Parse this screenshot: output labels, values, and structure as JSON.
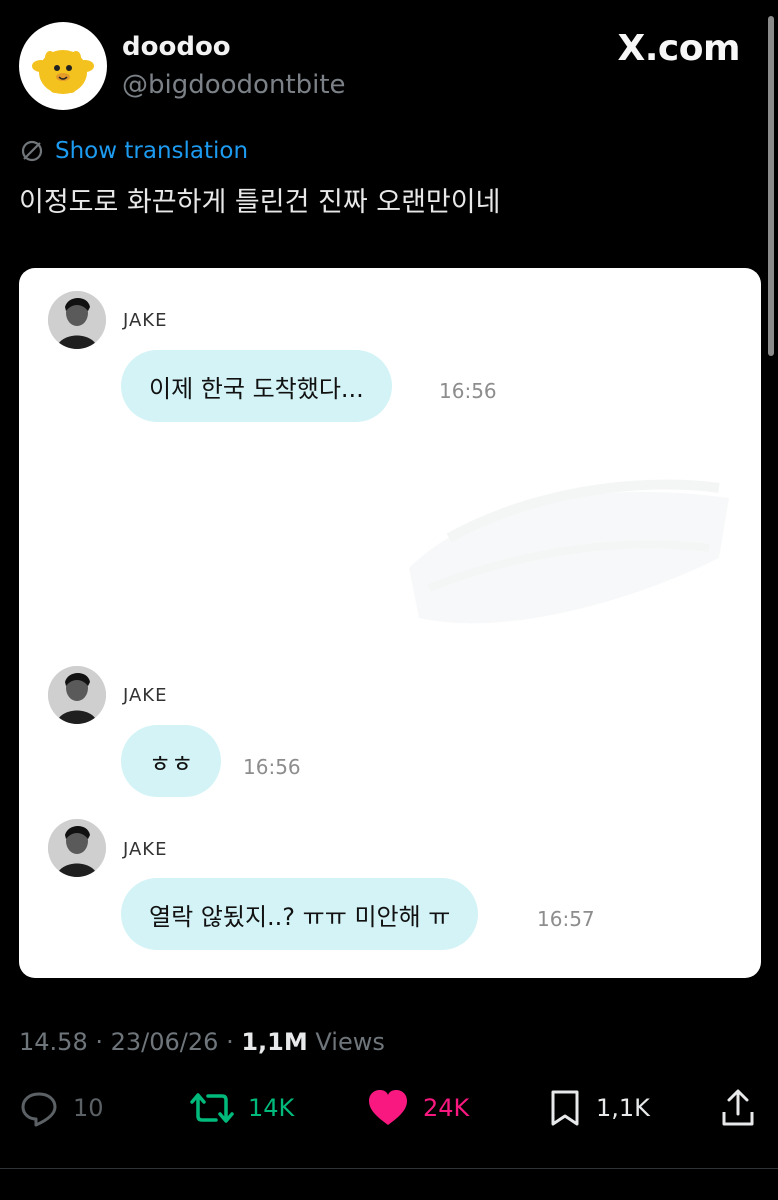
{
  "author": {
    "display_name": "doodoo",
    "handle": "@bigdoodontbite"
  },
  "site_logo": "X.com",
  "translation": {
    "link_label": "Show translation",
    "icon": "translate-icon"
  },
  "tweet_text": "이정도로 화끈하게 틀린건 진짜 오랜만이네",
  "chat": {
    "messages": [
      {
        "sender": "JAKE",
        "text": "이제 한국 도착했다...",
        "time": "16:56"
      },
      {
        "sender": "JAKE",
        "text": "ㅎㅎ",
        "time": "16:56"
      },
      {
        "sender": "JAKE",
        "text": "열락 않됬지..? ㅠㅠ 미안해 ㅠ",
        "time": "16:57"
      }
    ]
  },
  "meta": {
    "time": "14.58",
    "date": "23/06/26",
    "views_count": "1,1M",
    "views_label": "Views",
    "sep": "·"
  },
  "actions": {
    "reply_count": "10",
    "retweet_count": "14K",
    "like_count": "24K",
    "bookmark_count": "1,1K"
  },
  "colors": {
    "background": "#000000",
    "link": "#1d9bf0",
    "retweet": "#00ba7c",
    "like": "#f91880",
    "bubble": "#d3f3f6"
  }
}
